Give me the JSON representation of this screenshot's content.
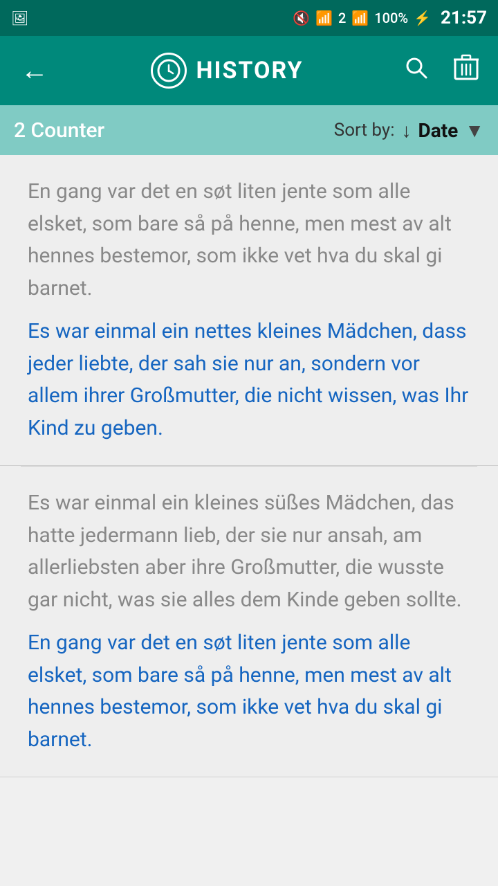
{
  "statusBar": {
    "time": "21:57",
    "battery": "100%",
    "icons": [
      "image-icon",
      "mute-icon",
      "wifi-icon",
      "sim2-icon",
      "signal-icon",
      "battery-icon",
      "charging-icon"
    ]
  },
  "appBar": {
    "backLabel": "←",
    "clockIcon": "🕐",
    "title": "HISTORY",
    "searchIcon": "search",
    "deleteIcon": "delete"
  },
  "subHeader": {
    "counterText": "2 Counter",
    "sortLabel": "Sort by:",
    "sortArrow": "↓",
    "sortValue": "Date",
    "dropdownIcon": "▼"
  },
  "entries": [
    {
      "original": "En gang var det en søt liten jente som alle elsket, som bare så på henne, men mest av alt hennes bestemor, som ikke vet hva du skal gi barnet.",
      "translation": "Es war einmal ein nettes kleines Mädchen, dass jeder liebte, der sah sie nur an, sondern vor allem ihrer Großmutter, die nicht wissen, was Ihr Kind zu geben."
    },
    {
      "original": "Es war einmal ein kleines süßes Mädchen, das hatte jedermann lieb, der sie nur ansah, am allerliebsten aber ihre Großmutter, die wusste gar nicht, was sie alles dem Kinde geben sollte.",
      "translation": "En gang var det en søt liten jente som alle elsket, som bare så på henne, men mest av alt hennes bestemor, som ikke vet hva du skal gi barnet."
    }
  ]
}
